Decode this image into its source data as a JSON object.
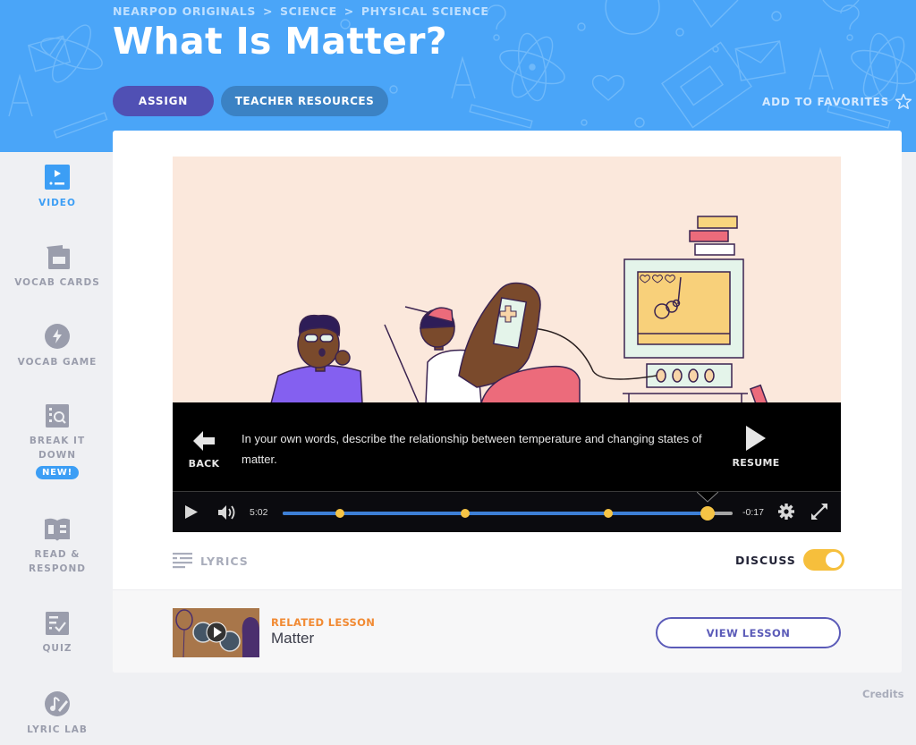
{
  "header": {
    "breadcrumb": [
      "NEARPOD ORIGINALS",
      "SCIENCE",
      "PHYSICAL SCIENCE"
    ],
    "breadcrumb_separator": ">",
    "title": "What Is Matter?",
    "assign_label": "ASSIGN",
    "teacher_resources_label": "TEACHER RESOURCES",
    "add_favorites_label": "ADD TO FAVORITES",
    "colors": {
      "background": "#4aa5f8",
      "assign": "#5050b4",
      "teacher_resources": "#3b82c4"
    }
  },
  "sidebar": {
    "items": [
      {
        "label": "VIDEO",
        "icon": "video-icon",
        "active": true
      },
      {
        "label": "VOCAB CARDS",
        "icon": "vocab-cards-icon",
        "active": false
      },
      {
        "label": "VOCAB GAME",
        "icon": "lightning-icon",
        "active": false
      },
      {
        "label_line1": "BREAK IT",
        "label_line2": "DOWN",
        "icon": "magnifier-icon",
        "active": false,
        "badge": "NEW!"
      },
      {
        "label_line1": "READ &",
        "label_line2": "RESPOND",
        "icon": "book-icon",
        "active": false
      },
      {
        "label": "QUIZ",
        "icon": "quiz-check-icon",
        "active": false
      },
      {
        "label": "LYRIC LAB",
        "icon": "music-pen-icon",
        "active": false
      }
    ],
    "active_color": "#3c9ef5"
  },
  "video": {
    "question": "In your own words, describe the relationship between temperature and changing states of matter.",
    "back_label": "BACK",
    "resume_label": "RESUME",
    "elapsed": "5:02",
    "remaining": "-0:17",
    "progress_fraction": 0.944,
    "marker_fractions": [
      0.128,
      0.406,
      0.724
    ],
    "colors": {
      "progress": "#3d7fd6",
      "marker": "#f6c445"
    }
  },
  "below_video": {
    "lyrics_label": "LYRICS",
    "discuss_label": "DISCUSS",
    "discuss_on": true
  },
  "related": {
    "label": "RELATED LESSON",
    "title": "Matter",
    "view_label": "VIEW LESSON"
  },
  "footer": {
    "credits_label": "Credits"
  }
}
